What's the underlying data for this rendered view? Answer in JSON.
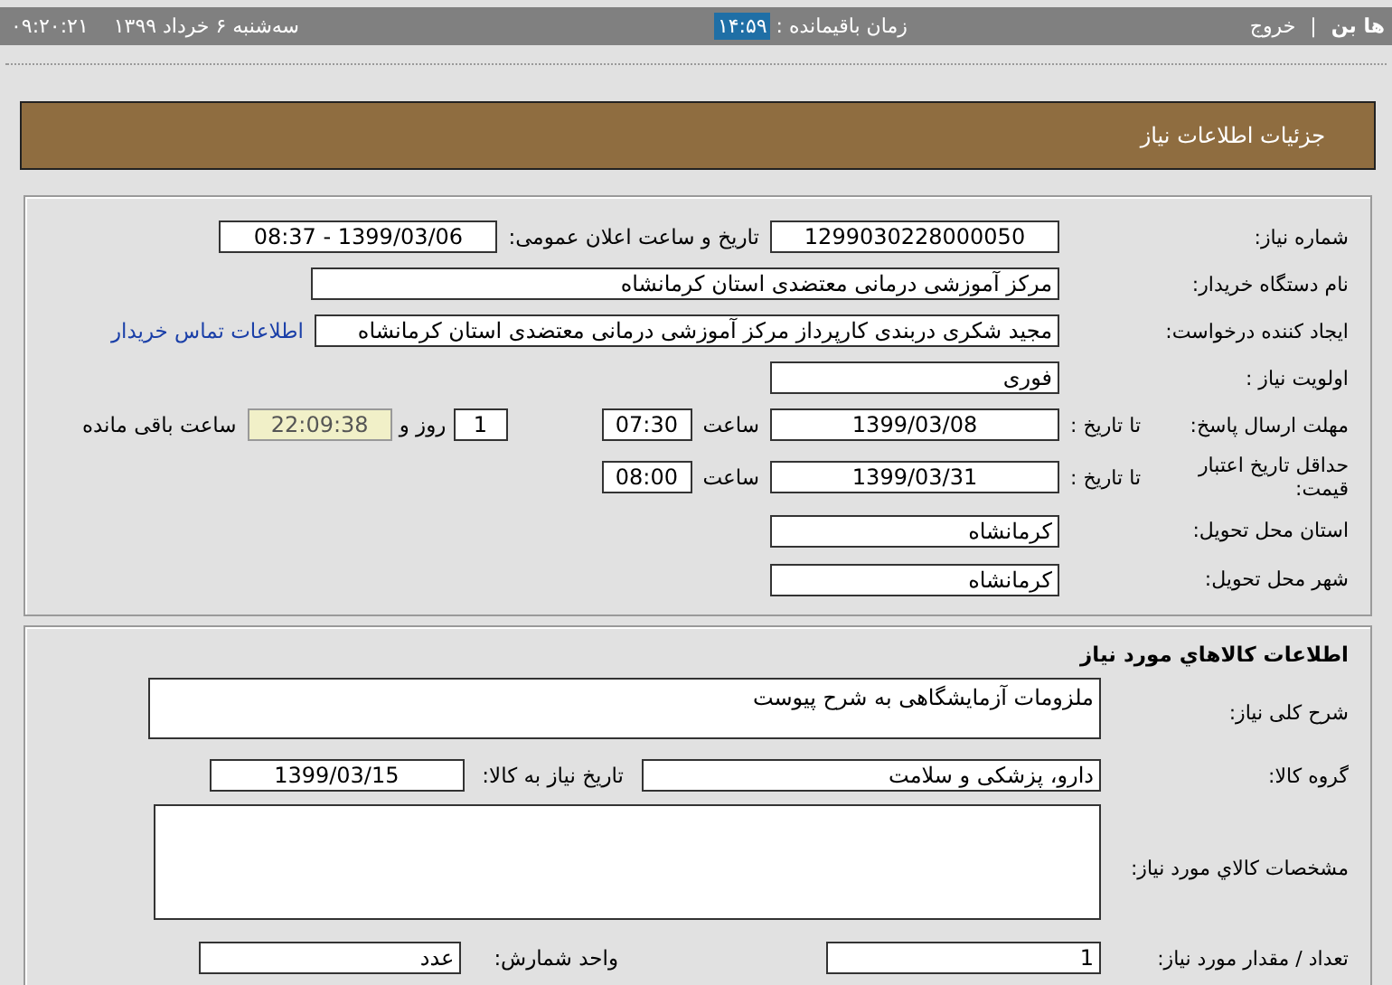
{
  "top_bar": {
    "user": "ها بن",
    "separator": "|",
    "logout": "خروج",
    "remaining_label": "زمان باقیمانده :",
    "remaining_time": "۱۴:۵۹",
    "clock": "۰۹:۲۰:۲۱",
    "date": "سه‌شنبه ۶ خرداد ۱۳۹۹"
  },
  "page_header": {
    "title": "جزئیات اطلاعات نیاز"
  },
  "need_details": {
    "rows": [
      {
        "label": "شماره نیاز:",
        "items": [
          {
            "kind": "field",
            "value": "1299030228000050"
          },
          {
            "kind": "text",
            "text": "تاریخ و ساعت اعلان عمومی:"
          },
          {
            "kind": "field",
            "value": "1399/03/06 - 08:37"
          }
        ]
      },
      {
        "label": "نام دستگاه خریدار:",
        "items": [
          {
            "kind": "field",
            "value": "مرکز آموزشی درمانی معتضدی استان کرمانشاه"
          }
        ]
      },
      {
        "label": "ایجاد کننده درخواست:",
        "items": [
          {
            "kind": "field",
            "value": "مجید شکری دربندی کارپرداز مرکز آموزشی درمانی معتضدی استان کرمانشاه"
          },
          {
            "kind": "link",
            "text": "اطلاعات تماس خریدار"
          }
        ]
      },
      {
        "label": "اولویت نیاز :",
        "items": [
          {
            "kind": "field",
            "value": "فوری"
          }
        ]
      },
      {
        "label": "مهلت ارسال پاسخ:",
        "sublabel": "تا تاریخ :",
        "items": [
          {
            "kind": "field",
            "value": "1399/03/08"
          },
          {
            "kind": "text",
            "text": "ساعت"
          },
          {
            "kind": "field",
            "value": "07:30"
          },
          {
            "kind": "field",
            "value": "1"
          },
          {
            "kind": "text",
            "text": "روز و"
          },
          {
            "kind": "countdown",
            "value": "22:09:38"
          },
          {
            "kind": "text",
            "text": "ساعت باقی مانده"
          }
        ]
      },
      {
        "label": "حداقل تاریخ اعتبار قیمت:",
        "sublabel": "تا تاریخ :",
        "items": [
          {
            "kind": "field",
            "value": "1399/03/31"
          },
          {
            "kind": "text",
            "text": "ساعت"
          },
          {
            "kind": "field",
            "value": "08:00"
          }
        ]
      },
      {
        "label": "استان محل تحویل:",
        "items": [
          {
            "kind": "field",
            "value": "کرمانشاه"
          }
        ]
      },
      {
        "label": "شهر محل تحویل:",
        "items": [
          {
            "kind": "field",
            "value": "کرمانشاه"
          }
        ]
      }
    ]
  },
  "goods": {
    "title": "اطلاعات كالاهاي مورد نياز",
    "rows": [
      {
        "label": "شرح کلی نیاز:",
        "items": [
          {
            "kind": "textarea",
            "value": "ملزومات آزمایشگاهی به شرح پیوست"
          }
        ]
      },
      {
        "label": "گروه کالا:",
        "items": [
          {
            "kind": "field",
            "value": "دارو، پزشکی و سلامت"
          },
          {
            "kind": "text",
            "text": "تاریخ نیاز به کالا:"
          },
          {
            "kind": "field",
            "value": "1399/03/15"
          }
        ]
      },
      {
        "label": "مشخصات كالاي مورد نياز:",
        "items": [
          {
            "kind": "textarea_tall"
          }
        ]
      },
      {
        "label": "تعداد / مقدار مورد نیاز:",
        "items": [
          {
            "kind": "field",
            "value": "1"
          },
          {
            "kind": "text",
            "text": "واحد شمارش:"
          },
          {
            "kind": "field",
            "value": "عدد"
          }
        ]
      }
    ]
  }
}
